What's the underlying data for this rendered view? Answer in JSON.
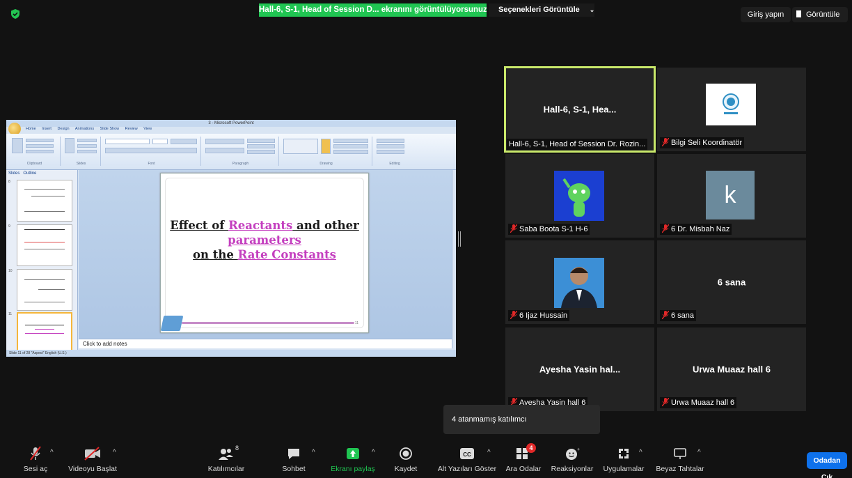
{
  "top": {
    "share_banner": "Hall-6, S-1, Head of Session D... ekranını görüntülüyorsunuz",
    "view_options": "Seçenekleri Görüntüle",
    "sign_in": "Giriş yapın",
    "view": "Görüntüle"
  },
  "shared_screen": {
    "window_title": "3 - Microsoft PowerPoint",
    "tabs": [
      "Home",
      "Insert",
      "Design",
      "Animations",
      "Slide Show",
      "Review",
      "View"
    ],
    "ribbon_groups": [
      "Clipboard",
      "Slides",
      "Font",
      "Paragraph",
      "Drawing",
      "Editing"
    ],
    "panel_tabs": [
      "Slides",
      "Outline"
    ],
    "thumb_numbers": [
      "8",
      "9",
      "10",
      "11"
    ],
    "slide": {
      "line1_a": "Effect of ",
      "line1_b": "Reactants",
      "line1_c": " and other",
      "line2": "parameters",
      "line3_a": "on the ",
      "line3_b": "Rate Constants",
      "number": "11"
    },
    "notes_placeholder": "Click to add notes",
    "status": "Slide 11 of 28   \"Aspect\"   English (U.S.)"
  },
  "participants": [
    {
      "display": "Hall-6, S-1, Hea...",
      "name": "Hall-6, S-1, Head of Session Dr. Rozin...",
      "muted": false,
      "active": true
    },
    {
      "display": "",
      "name": "Bilgi Seli Koordinatör",
      "muted": true,
      "avatar": "bilsel-logo"
    },
    {
      "display": "",
      "name": "Saba Boota S-1 H-6",
      "muted": true,
      "avatar": "alien-avatar"
    },
    {
      "display": "k",
      "name": "6 Dr. Misbah Naz",
      "muted": true,
      "avatar": "letter-k"
    },
    {
      "display": "",
      "name": "6 Ijaz Hussain",
      "muted": true,
      "avatar": "photo"
    },
    {
      "display": "6 sana",
      "name": "6 sana",
      "muted": true
    },
    {
      "display": "Ayesha Yasin hal...",
      "name": "Ayesha Yasin hall 6",
      "muted": true
    },
    {
      "display": "Urwa Muaaz hall 6",
      "name": "Urwa Muaaz hall 6",
      "muted": true
    }
  ],
  "tooltip": "4 atanmamış katılımcı",
  "toolbar": {
    "unmute": "Sesi aç",
    "start_video": "Videoyu Başlat",
    "participants": "Katılımcılar",
    "participant_count": "8",
    "chat": "Sohbet",
    "share": "Ekranı paylaş",
    "record": "Kaydet",
    "captions": "Alt Yazıları Göster",
    "breakout": "Ara Odalar",
    "breakout_badge": "4",
    "reactions": "Reaksiyonlar",
    "apps": "Uygulamalar",
    "whiteboard": "Beyaz Tahtalar",
    "leave": "Odadan Çık"
  },
  "colors": {
    "share_green": "#20c552",
    "active_border": "#c9e86a",
    "leave_blue": "#0e71eb",
    "mute_red": "#e02828",
    "badge_red": "#e02828"
  }
}
